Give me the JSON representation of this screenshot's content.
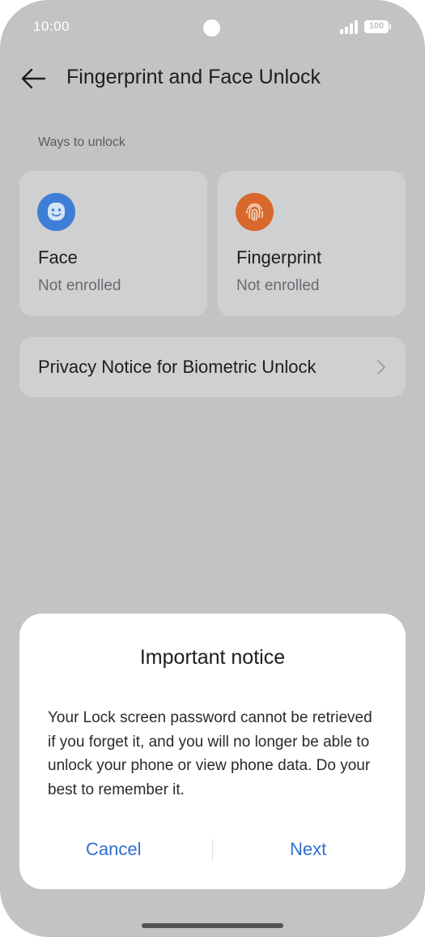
{
  "status_bar": {
    "time": "10:00",
    "battery": "100"
  },
  "header": {
    "title": "Fingerprint and Face Unlock"
  },
  "section": {
    "label": "Ways to unlock"
  },
  "methods": [
    {
      "name": "Face",
      "status": "Not enrolled",
      "icon": "face-smile-icon",
      "color": "#3d7fd6"
    },
    {
      "name": "Fingerprint",
      "status": "Not enrolled",
      "icon": "fingerprint-icon",
      "color": "#d8682c"
    }
  ],
  "privacy": {
    "label": "Privacy Notice for Biometric Unlock"
  },
  "dialog": {
    "title": "Important notice",
    "body": "Your Lock screen password cannot be retrieved if you forget it, and you will no longer be able to unlock your phone or view phone data. Do your best to remember it.",
    "cancel_label": "Cancel",
    "next_label": "Next",
    "accent": "#2f6fd1"
  }
}
